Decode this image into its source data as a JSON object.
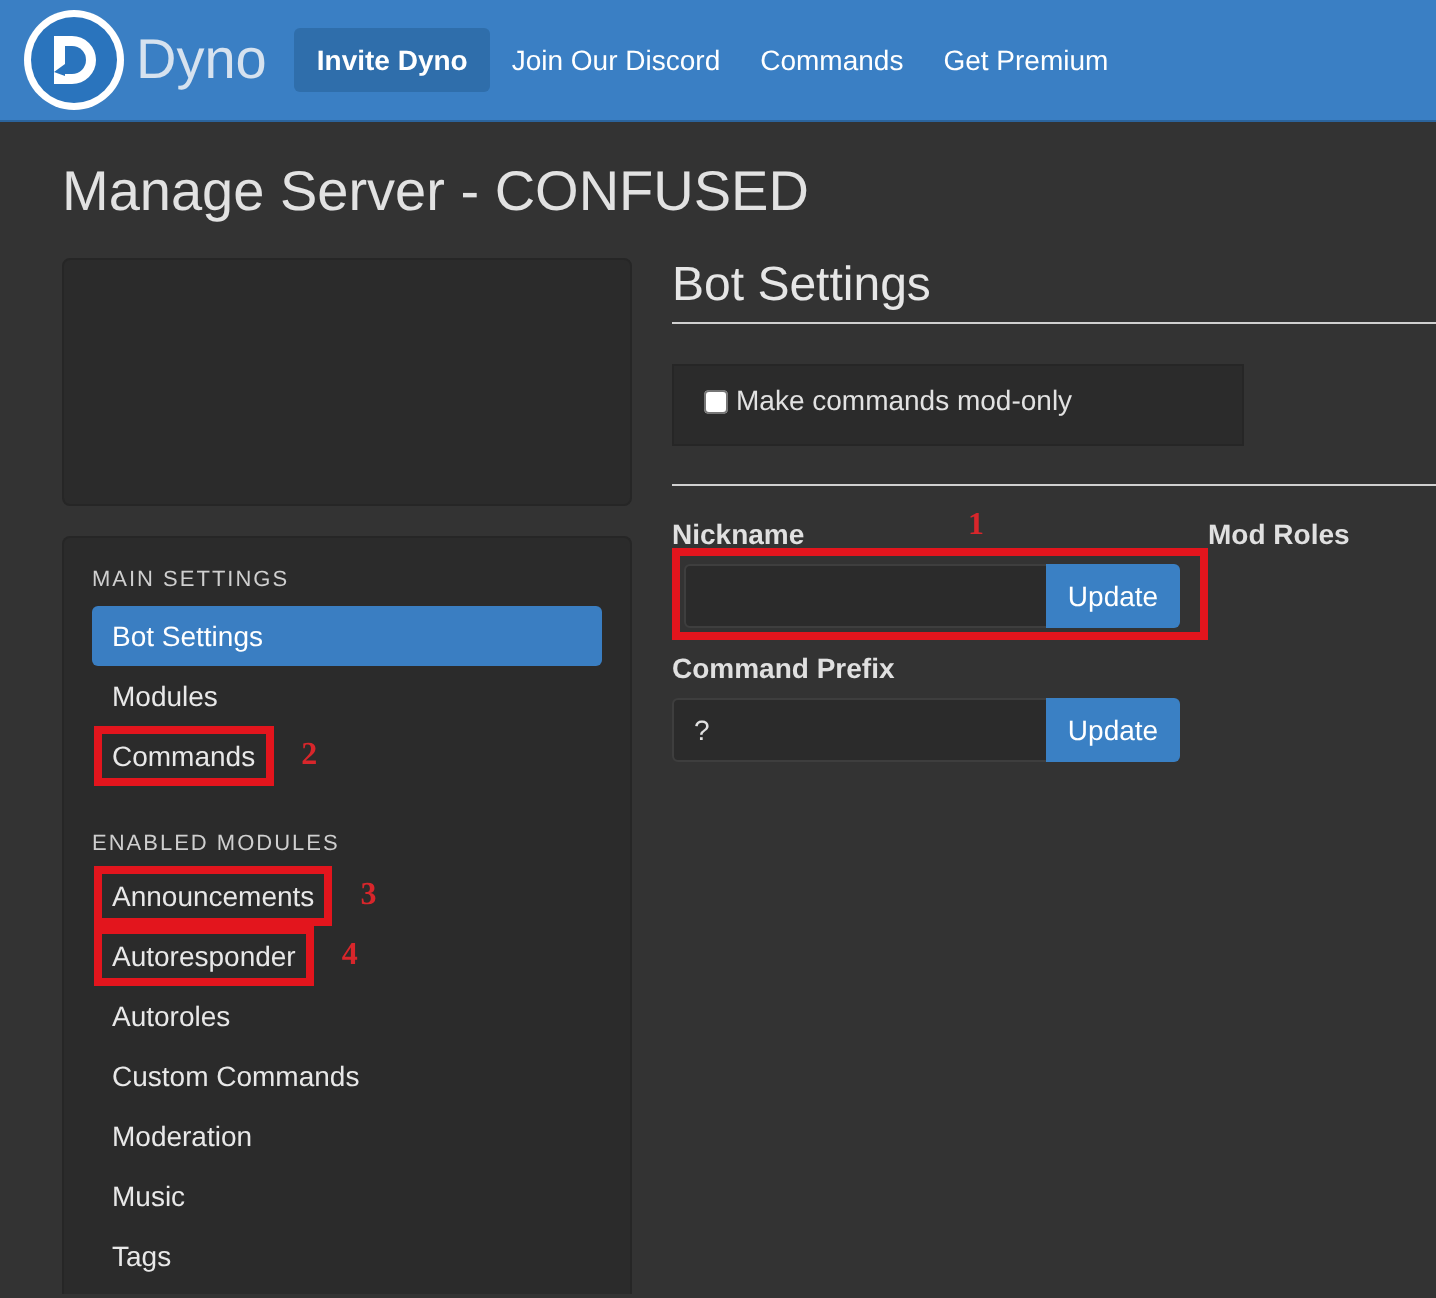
{
  "navbar": {
    "brand": "Dyno",
    "links": [
      {
        "label": "Invite Dyno",
        "selected": true
      },
      {
        "label": "Join Our Discord",
        "selected": false
      },
      {
        "label": "Commands",
        "selected": false
      },
      {
        "label": "Get Premium",
        "selected": false
      }
    ]
  },
  "page_title": "Manage Server - CONFUSED",
  "sidebar": {
    "sections": [
      {
        "heading": "MAIN SETTINGS",
        "items": [
          {
            "label": "Bot Settings",
            "selected": true
          },
          {
            "label": "Modules",
            "selected": false
          },
          {
            "label": "Commands",
            "selected": false,
            "callout": "2"
          }
        ]
      },
      {
        "heading": "ENABLED MODULES",
        "items": [
          {
            "label": "Announcements",
            "selected": false,
            "callout": "3"
          },
          {
            "label": "Autoresponder",
            "selected": false,
            "callout": "4"
          },
          {
            "label": "Autoroles",
            "selected": false
          },
          {
            "label": "Custom Commands",
            "selected": false
          },
          {
            "label": "Moderation",
            "selected": false
          },
          {
            "label": "Music",
            "selected": false
          },
          {
            "label": "Tags",
            "selected": false
          }
        ]
      }
    ]
  },
  "settings": {
    "title": "Bot Settings",
    "checkbox": {
      "label": "Make commands mod-only",
      "checked": false
    },
    "fields": [
      {
        "label": "Nickname",
        "button": "Update",
        "callout": "1"
      },
      {
        "label": "Command Prefix",
        "value": "?",
        "button": "Update"
      }
    ],
    "mod_roles": {
      "label": "Mod Roles"
    }
  }
}
